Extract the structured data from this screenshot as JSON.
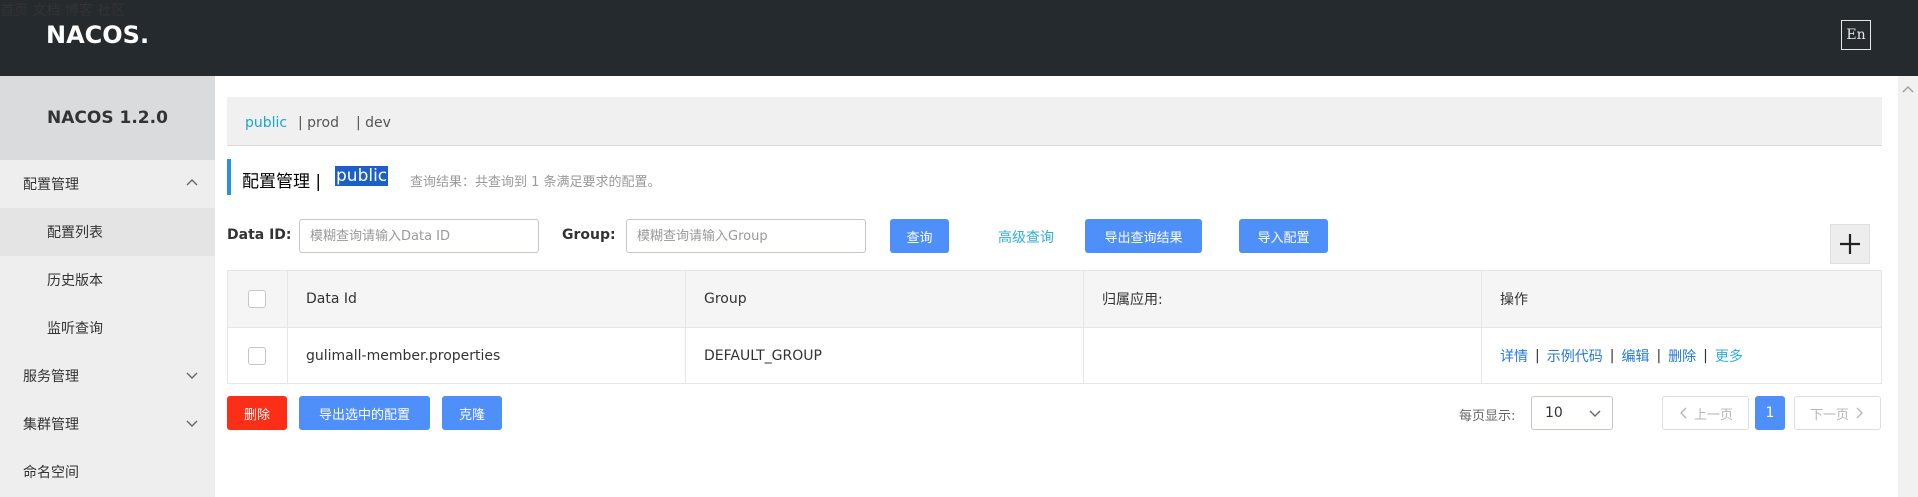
{
  "header": {
    "logo_text": "NACOS.",
    "nav": [
      "首页",
      "文档",
      "博客",
      "社区"
    ],
    "lang": "En"
  },
  "sidebar": {
    "version": "NACOS 1.2.0",
    "items": [
      {
        "label": "配置管理"
      },
      {
        "label": "配置列表"
      },
      {
        "label": "历史版本"
      },
      {
        "label": "监听查询"
      },
      {
        "label": "服务管理"
      },
      {
        "label": "集群管理"
      },
      {
        "label": "命名空间"
      }
    ]
  },
  "namespaces": {
    "active": "public",
    "others": [
      "| prod",
      "| dev"
    ]
  },
  "title": {
    "text": "配置管理 |",
    "namespace": "public",
    "result": "查询结果：共查询到 1 条满足要求的配置。"
  },
  "search": {
    "data_id_label": "Data ID:",
    "data_id_placeholder": "模糊查询请输入Data ID",
    "group_label": "Group:",
    "group_placeholder": "模糊查询请输入Group",
    "query_button": "查询",
    "advanced_link": "高级查询",
    "export_button": "导出查询结果",
    "import_button": "导入配置"
  },
  "table": {
    "columns": [
      "Data Id",
      "Group",
      "归属应用:",
      "操作"
    ],
    "rows": [
      {
        "data_id": "gulimall-member.properties",
        "group": "DEFAULT_GROUP",
        "app": "",
        "ops": [
          "详情",
          "示例代码",
          "编辑",
          "删除",
          "更多"
        ]
      }
    ]
  },
  "footer": {
    "delete_button": "删除",
    "export_selected_button": "导出选中的配置",
    "clone_button": "克隆",
    "page_size_label": "每页显示:",
    "page_size": "10",
    "prev": "上一页",
    "current_page": "1",
    "next": "下一页"
  },
  "colors": {
    "header_bg": "#252a2f",
    "primary": "#4f8ff9",
    "danger": "#fb2e17",
    "link": "#2fb0dc"
  }
}
